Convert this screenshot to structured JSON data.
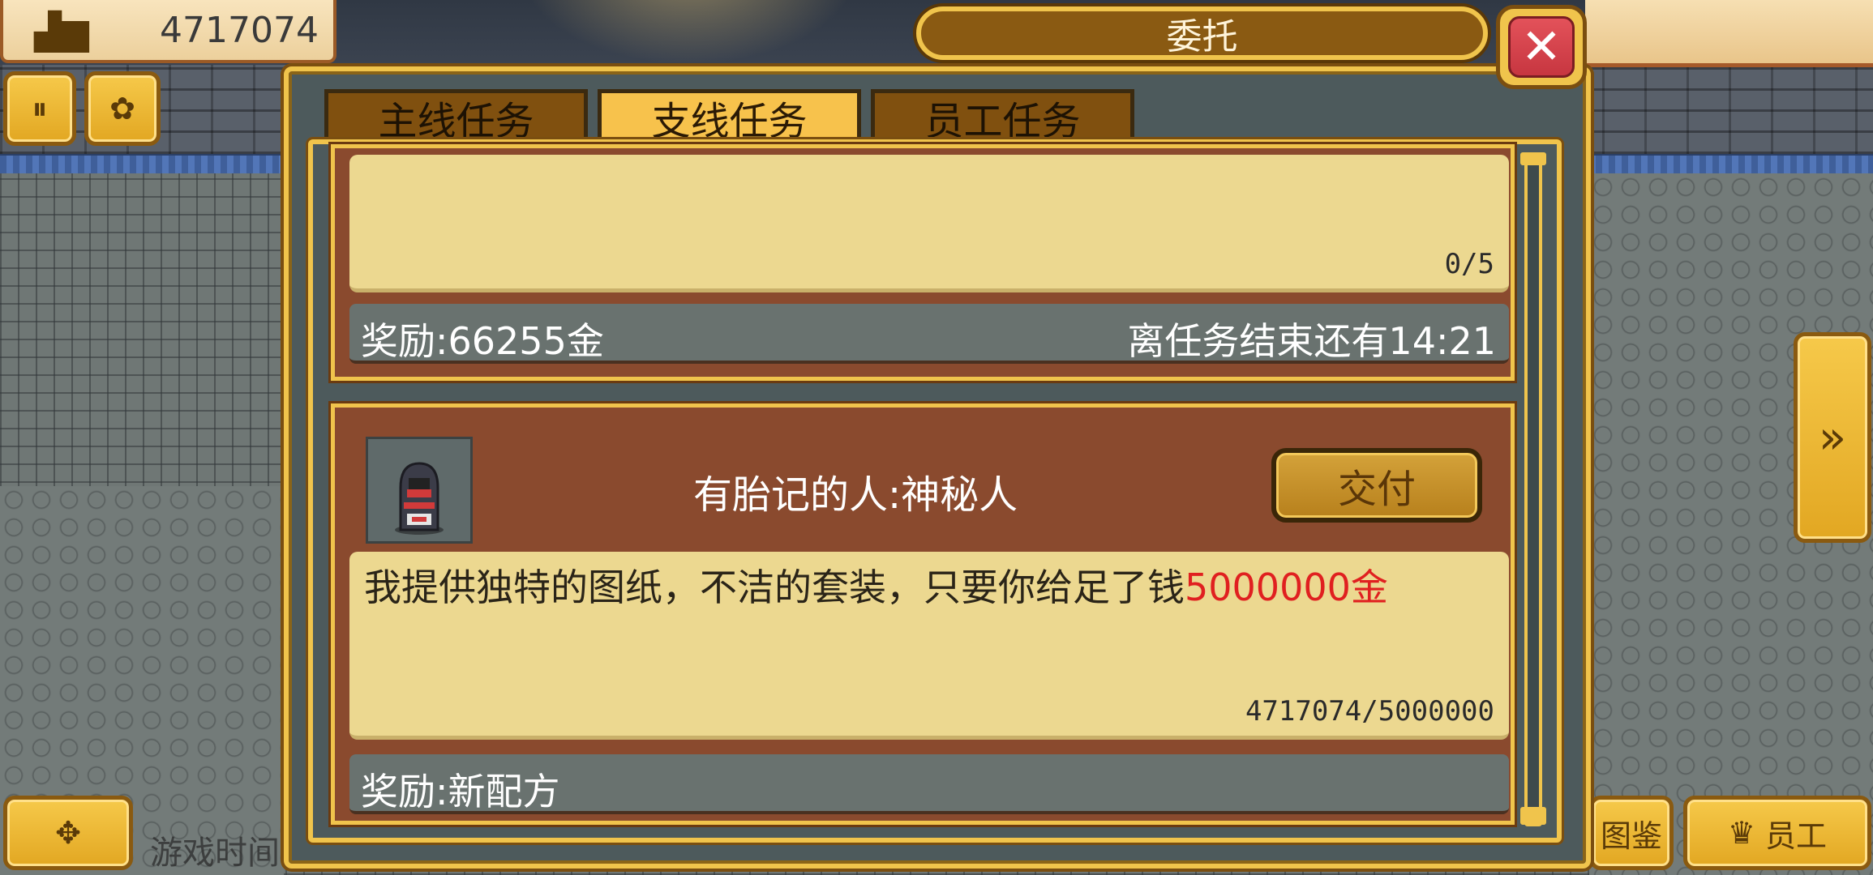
{
  "hud": {
    "money": "4717074",
    "money_icon": "gold-stack-icon",
    "game_time_label": "游戏时间"
  },
  "side_buttons": {
    "pause_icon": "pause-icon",
    "pause_glyph": "⏸",
    "map_icon": "map-icon",
    "map_glyph": "✿",
    "direction_icon": "dpad-icon",
    "direction_glyph": "✥",
    "next_icon": "double-arrow-right-icon",
    "next_glyph": "»",
    "collection_label": "图鉴",
    "staff_label": "员工",
    "staff_icon": "crown-icon",
    "staff_glyph": "♛"
  },
  "dialog": {
    "title": "委托",
    "close_glyph": "✕",
    "tabs": [
      {
        "label": "主线任务",
        "active": false
      },
      {
        "label": "支线任务",
        "active": true
      },
      {
        "label": "员工任务",
        "active": false
      }
    ]
  },
  "quests": [
    {
      "description": "",
      "progress": "0/5",
      "reward": "奖励:66255金",
      "time_left": "离任务结束还有14:21"
    },
    {
      "npc_name": "有胎记的人:神秘人",
      "deliver_label": "交付",
      "description_prefix": "我提供独特的图纸，不洁的套装，只要你给足了钱",
      "description_highlight": "5000000金",
      "progress": "4717074/5000000",
      "reward": "奖励:新配方"
    }
  ],
  "colors": {
    "gold_border": "#f0c44c",
    "card_brown": "#8a4a2e",
    "desc_bg": "#ecd890",
    "reward_bg": "#69726f",
    "highlight_red": "#e02020",
    "active_tab": "#f7c24c"
  }
}
